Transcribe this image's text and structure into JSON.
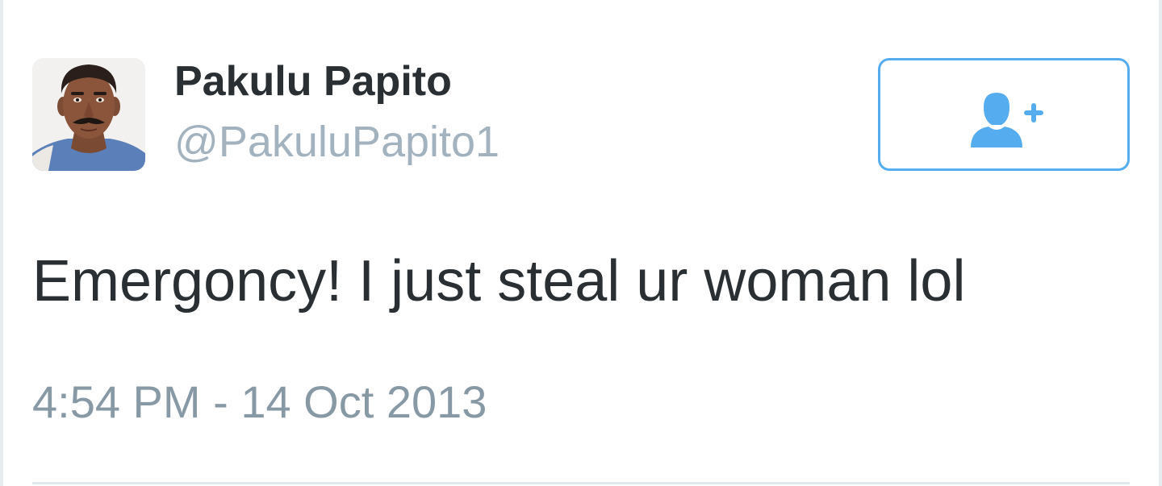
{
  "tweet": {
    "display_name": "Pakulu Papito",
    "handle": "@PakuluPapito1",
    "text": "Emergoncy! I just steal ur woman lol",
    "timestamp": "4:54 PM - 14 Oct 2013"
  },
  "follow_button": {
    "icon": "follow-user-plus-icon"
  },
  "colors": {
    "accent": "#55acee",
    "text_primary": "#292f33",
    "text_secondary": "#8899a6",
    "handle": "#a2b2bf",
    "divider": "#e1e8ed"
  }
}
